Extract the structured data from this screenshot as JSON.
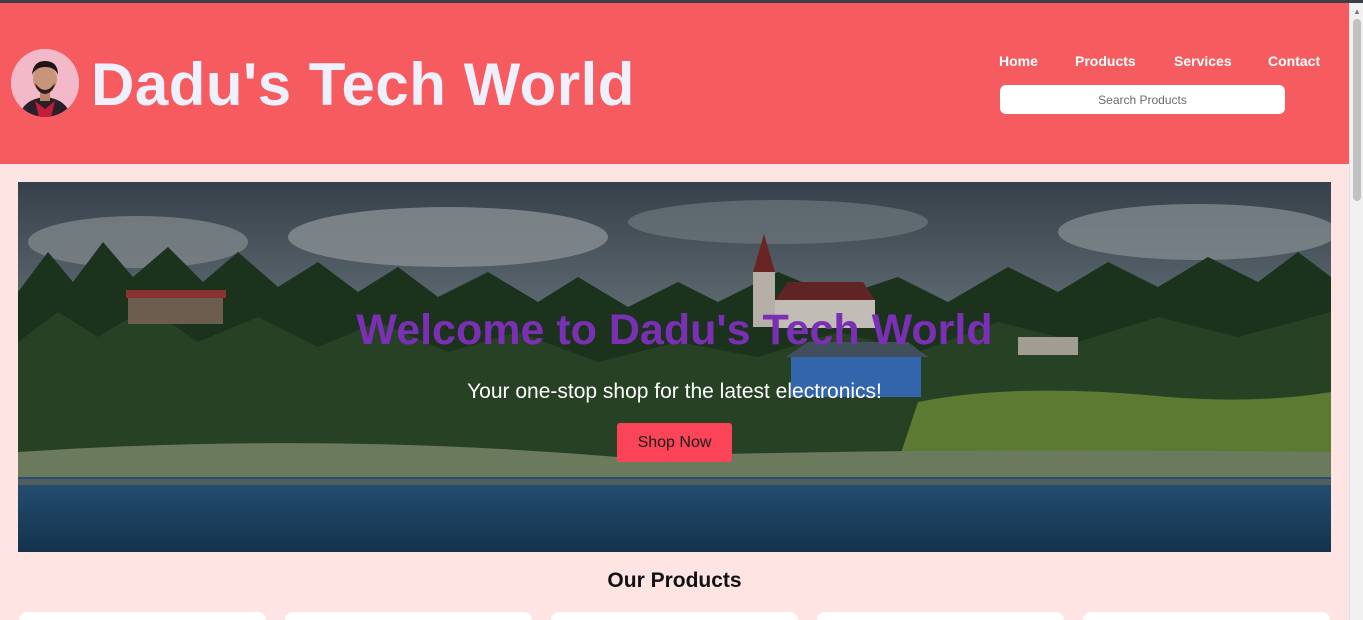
{
  "header": {
    "brand_title": "Dadu's Tech World",
    "nav": [
      "Home",
      "Products",
      "Services",
      "Contact"
    ],
    "search_placeholder": "Search Products",
    "colors": {
      "header_bg": "#f65b60",
      "page_bg": "#ffe4e4"
    }
  },
  "hero": {
    "title": "Welcome to Dadu's Tech World",
    "subtitle": "Your one-stop shop for the latest electronics!",
    "cta_label": "Shop Now",
    "colors": {
      "title": "#7a2fb5",
      "cta_bg": "#fb4458"
    }
  },
  "products": {
    "section_title": "Our Products",
    "card_count_visible": 5
  }
}
